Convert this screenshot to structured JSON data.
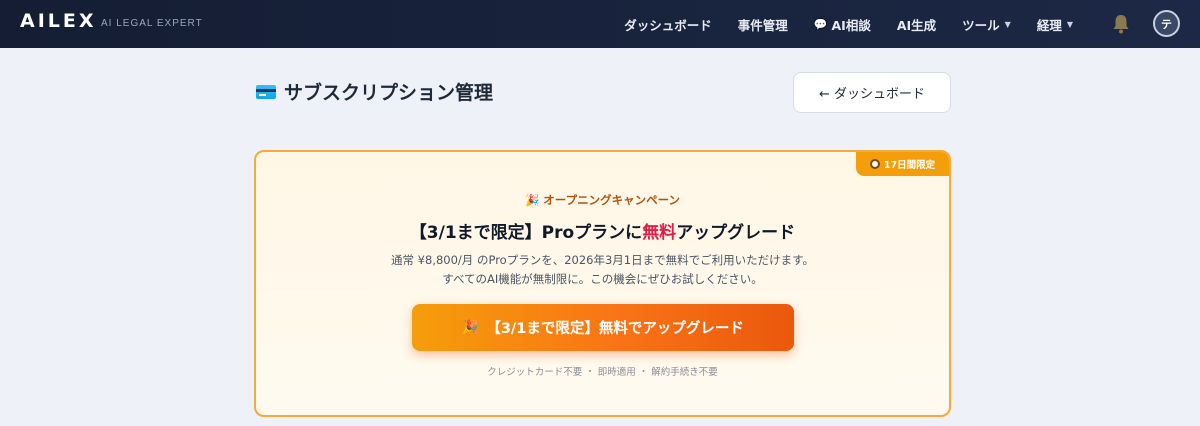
{
  "header": {
    "brand": "AILEX",
    "brand_sub": "AI LEGAL EXPERT",
    "nav": [
      {
        "label": "ダッシュボード"
      },
      {
        "label": "事件管理"
      },
      {
        "label": "AI相談",
        "icon": "chat-bubble-icon"
      },
      {
        "label": "AI生成"
      },
      {
        "label": "ツール",
        "has_dropdown": true
      },
      {
        "label": "経理",
        "has_dropdown": true
      }
    ],
    "avatar_initial": "テ"
  },
  "page": {
    "title": "サブスクリプション管理",
    "title_icon": "credit-card-icon",
    "back_button": "← ダッシュボード"
  },
  "campaign": {
    "badge": "17日間限定",
    "eyebrow": "🎉 オープニングキャンペーン",
    "title_prefix": "【3/1まで限定】Proプランに",
    "title_highlight": "無料",
    "title_suffix": "アップグレード",
    "desc_line1": "通常 ¥8,800/月 のProプランを、2026年3月1日まで無料でご利用いただけます。",
    "desc_line2": "すべてのAI機能が無制限に。この機会にぜひお試しください。",
    "cta_label": "【3/1まで限定】無料でアップグレード",
    "fine_print": "クレジットカード不要 ・ 即時適用 ・ 解約手続き不要"
  },
  "colors": {
    "header_bg": "#141d33",
    "accent_orange": "#f97316",
    "highlight_red": "#e11d48",
    "card_border": "#f6a93c"
  }
}
